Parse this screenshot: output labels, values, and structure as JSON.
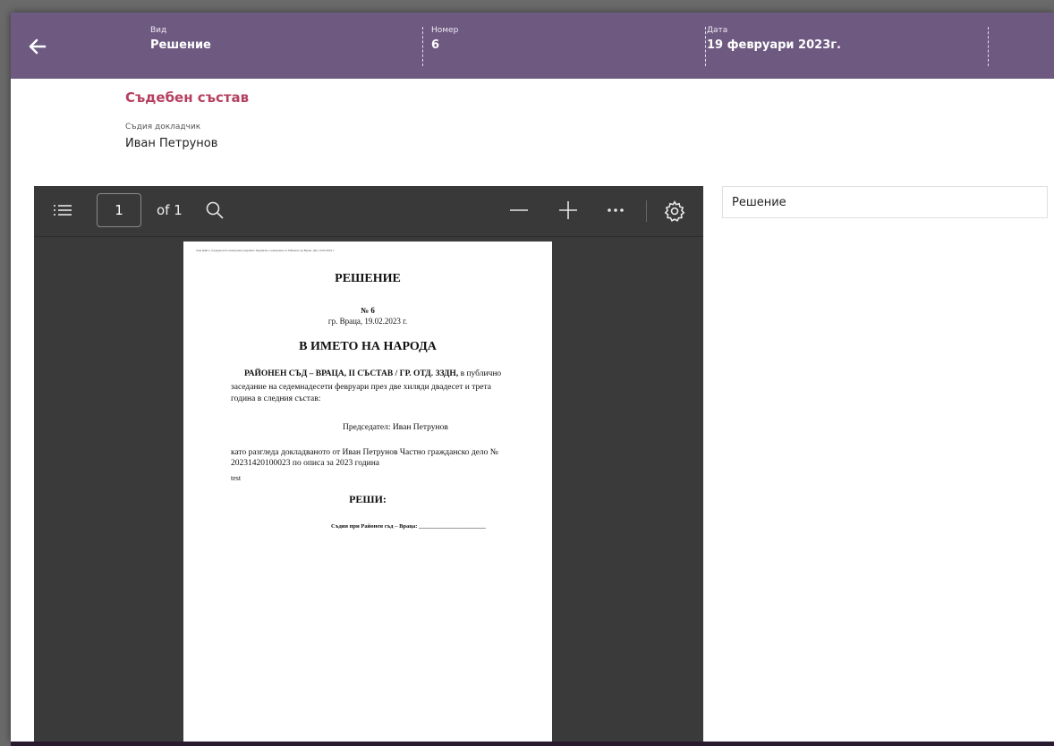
{
  "header": {
    "kind_label": "Вид",
    "kind_value": "Решение",
    "number_label": "Номер",
    "number_value": "6",
    "date_label": "Дата",
    "date_value": "19 февруари 2023г."
  },
  "composition": {
    "title": "Съдебен състав",
    "judge_label": "Съдия докладчик",
    "judge_value": "Иван Петрунов"
  },
  "viewer": {
    "page_current": "1",
    "page_total_text": "of 1"
  },
  "document": {
    "top_note": "Този файл е създаден като електронен документ. Подписан е електронно от Районен съд Враца. Дата 19.02.2023 г.",
    "heading": "РЕШЕНИЕ",
    "number_line": "№ 6",
    "place_date": "гр. Враца, 19.02.2023 г.",
    "people_heading": "В ИМЕТО НА НАРОДА",
    "court_bold": "РАЙОНЕН СЪД – ВРАЦА, II СЪСТАВ / ГР. ОТД. ЗЗДН,",
    "court_rest": " в публично",
    "session_line1": "заседание на седемнадесети февруари през две хиляди двадесет и трета",
    "session_line2": "година в следния състав:",
    "chair_line": "Председател:  Иван Петрунов",
    "case_line1": "като разгледа докладваното от Иван Петрунов Частно гражданско дело №",
    "case_line2": "20231420100023 по описа за 2023 година",
    "test_text": "test",
    "decided": "РЕШИ:",
    "signature": "Съдия при Районен съд – Враца: _______________________"
  },
  "side_panel": {
    "title": "Решение"
  }
}
